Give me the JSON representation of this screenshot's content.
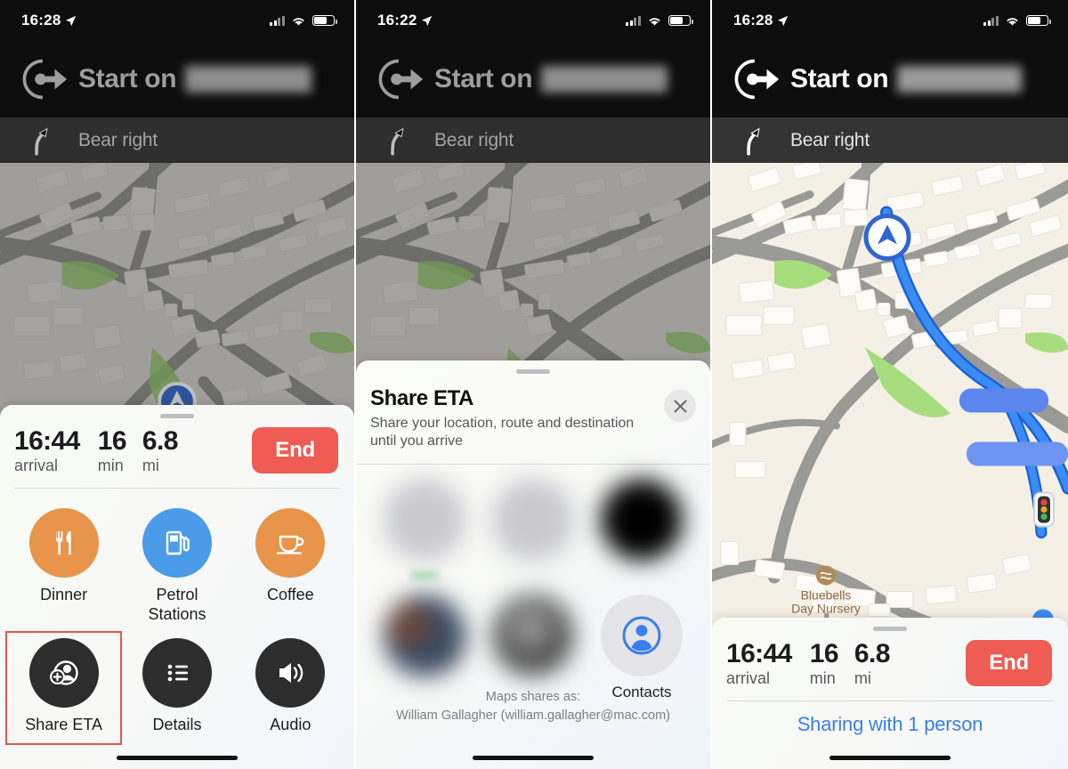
{
  "panels": [
    {
      "id": "panel-1-navigation-actions",
      "status_bar": {
        "time": "16:28",
        "location_icon": "location-arrow-icon",
        "cellular_icon": "signal-bars-icon",
        "wifi_icon": "wifi-icon",
        "battery_icon": "battery-icon"
      },
      "banner": {
        "maneuver_icon": "start-route-icon",
        "label": "Start on",
        "street_redacted": true
      },
      "sub_banner": {
        "maneuver_icon": "bear-right-arrow-icon",
        "label": "Bear right"
      },
      "card": {
        "grabber": "sheet-grabber",
        "eta": {
          "arrival_value": "16:44",
          "arrival_label": "arrival",
          "time_value": "16",
          "time_label": "min",
          "distance_value": "6.8",
          "distance_label": "mi"
        },
        "end_button": "End",
        "actions": [
          {
            "name": "dinner",
            "label": "Dinner",
            "icon": "fork-knife-icon",
            "color": "#e8944a"
          },
          {
            "name": "petrol-stations",
            "label": "Petrol\nStations",
            "label_line1": "Petrol",
            "label_line2": "Stations",
            "icon": "fuel-pump-icon",
            "color": "#4a9be8"
          },
          {
            "name": "coffee",
            "label": "Coffee",
            "icon": "coffee-cup-icon",
            "color": "#e8944a"
          },
          {
            "name": "share-eta",
            "label": "Share ETA",
            "icon": "person-badge-plus-icon",
            "color": "#2d2d2d",
            "highlighted": true,
            "highlight_color": "#e8554a"
          },
          {
            "name": "details",
            "label": "Details",
            "icon": "list-bullet-icon",
            "color": "#2d2d2d"
          },
          {
            "name": "audio",
            "label": "Audio",
            "icon": "speaker-wave-icon",
            "color": "#2d2d2d"
          }
        ]
      }
    },
    {
      "id": "panel-2-share-eta-sheet",
      "status_bar": {
        "time": "16:22",
        "location_icon": "location-arrow-icon",
        "cellular_icon": "signal-bars-icon",
        "wifi_icon": "wifi-icon",
        "battery_icon": "battery-icon"
      },
      "banner": {
        "maneuver_icon": "start-route-icon",
        "label": "Start on",
        "street_redacted": true
      },
      "sub_banner": {
        "maneuver_icon": "bear-right-arrow-icon",
        "label": "Bear right"
      },
      "sheet": {
        "title": "Share ETA",
        "subtitle": "Share your location, route and destination until you arrive",
        "close_icon": "close-x-icon",
        "recipients": [
          {
            "name": "recipient-1",
            "label": "SMS",
            "label_blurred": true,
            "avatar_blurred": true,
            "avatar_style": "gray"
          },
          {
            "name": "recipient-2",
            "label": "",
            "label_blurred": true,
            "avatar_blurred": true,
            "avatar_style": "gray"
          },
          {
            "name": "recipient-3",
            "label": "",
            "label_blurred": true,
            "avatar_blurred": true,
            "avatar_style": "black"
          },
          {
            "name": "recipient-4",
            "label": "",
            "label_blurred": true,
            "avatar_blurred": true,
            "avatar_style": "photo1"
          },
          {
            "name": "recipient-5",
            "label": "",
            "label_blurred": true,
            "avatar_blurred": true,
            "avatar_style": "photo2"
          },
          {
            "name": "contacts",
            "label": "Contacts",
            "label_blurred": false,
            "avatar_blurred": false,
            "avatar_style": "contacts",
            "icon": "person-circle-icon"
          }
        ],
        "footer_line1": "Maps shares as:",
        "footer_line2": "William Gallagher (william.gallagher@mac.com)"
      }
    },
    {
      "id": "panel-3-sharing-active",
      "status_bar": {
        "time": "16:28",
        "location_icon": "location-arrow-icon",
        "cellular_icon": "signal-bars-icon",
        "wifi_icon": "wifi-icon",
        "battery_icon": "battery-icon"
      },
      "banner": {
        "maneuver_icon": "start-route-icon",
        "label": "Start on",
        "street_redacted": true
      },
      "sub_banner": {
        "maneuver_icon": "bear-right-arrow-icon",
        "label": "Bear right"
      },
      "map": {
        "position_marker": "current-location-arrow-icon",
        "traffic_light_icon": "traffic-light-icon",
        "poi": {
          "icon": "nursery-poi-icon",
          "line1": "Bluebells",
          "line2": "Day Nursery"
        }
      },
      "card": {
        "grabber": "sheet-grabber",
        "eta": {
          "arrival_value": "16:44",
          "arrival_label": "arrival",
          "time_value": "16",
          "time_label": "min",
          "distance_value": "6.8",
          "distance_label": "mi"
        },
        "end_button": "End",
        "sharing_status": "Sharing with 1 person"
      }
    }
  ],
  "colors": {
    "end_button": "#ee5c53",
    "accent_blue": "#3a7ff0",
    "highlight_box": "#e8554a",
    "orange_icon": "#e8944a",
    "blue_icon": "#4a9be8",
    "dark_icon": "#2d2d2d",
    "map_land": "#f5f0e5",
    "map_road": "#9a9a96",
    "map_green": "#a8dd7d",
    "route_blue": "#2d7ff0"
  }
}
